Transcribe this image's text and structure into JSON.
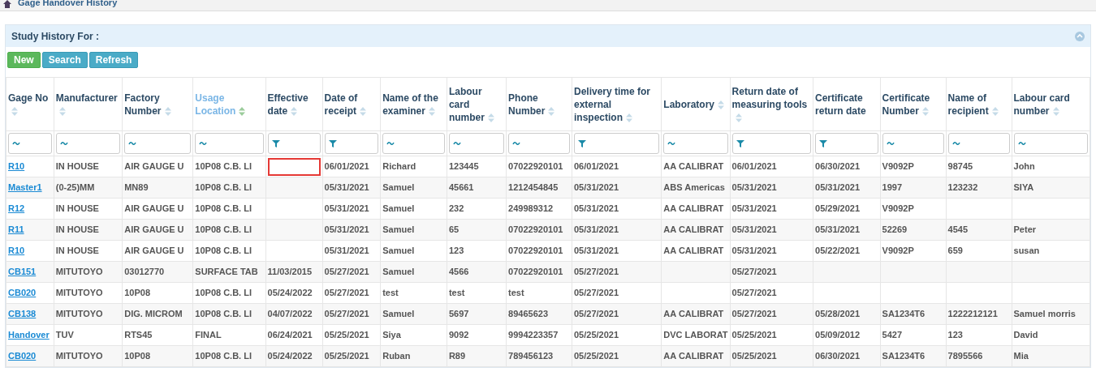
{
  "breadcrumb": {
    "title": "Gage Handover History"
  },
  "panel": {
    "title": "Study History For :",
    "collapsed": false
  },
  "buttons": [
    {
      "label": "New",
      "kind": "success"
    },
    {
      "label": "Search",
      "kind": "info"
    },
    {
      "label": "Refresh",
      "kind": "info"
    }
  ],
  "table": {
    "columns": [
      {
        "label": "Gage No",
        "sortable": true,
        "sorted": false,
        "filter": {
          "kind": "text"
        }
      },
      {
        "label": "Manufacturer",
        "sortable": true,
        "sorted": false,
        "filter": {
          "kind": "text"
        }
      },
      {
        "label": "Factory Number",
        "sortable": true,
        "sorted": false,
        "filter": {
          "kind": "text"
        }
      },
      {
        "label": "Usage Location",
        "sortable": true,
        "sorted": true,
        "filter": {
          "kind": "text"
        }
      },
      {
        "label": "Effective date",
        "sortable": true,
        "sorted": false,
        "filter": {
          "kind": "date"
        }
      },
      {
        "label": "Date of receipt",
        "sortable": true,
        "sorted": false,
        "filter": {
          "kind": "date"
        }
      },
      {
        "label": "Name of the examiner",
        "sortable": true,
        "sorted": false,
        "filter": {
          "kind": "text"
        }
      },
      {
        "label": "Labour card number",
        "sortable": true,
        "sorted": false,
        "filter": {
          "kind": "text"
        }
      },
      {
        "label": "Phone Number",
        "sortable": true,
        "sorted": false,
        "filter": {
          "kind": "text"
        }
      },
      {
        "label": "Delivery time for external inspection",
        "sortable": true,
        "sorted": false,
        "filter": {
          "kind": "date"
        }
      },
      {
        "label": "Laboratory",
        "sortable": true,
        "sorted": false,
        "filter": {
          "kind": "text"
        }
      },
      {
        "label": "Return date of measuring tools",
        "sortable": true,
        "sorted": false,
        "filter": {
          "kind": "date"
        }
      },
      {
        "label": "Certificate return date",
        "sortable": false,
        "sorted": false,
        "filter": {
          "kind": "date"
        }
      },
      {
        "label": "Certificate Number",
        "sortable": true,
        "sorted": false,
        "filter": {
          "kind": "text"
        }
      },
      {
        "label": "Name of recipient",
        "sortable": true,
        "sorted": false,
        "filter": {
          "kind": "text"
        }
      },
      {
        "label": "Labour card number",
        "sortable": true,
        "sorted": false,
        "filter": {
          "kind": "text"
        }
      }
    ],
    "rows": [
      {
        "cells": [
          "R10",
          "IN HOUSE",
          "AIR GAUGE U",
          "10P08 C.B. LI",
          {
            "text": "",
            "outlined": true
          },
          "06/01/2021",
          "Richard",
          "123445",
          "07022920101",
          "06/01/2021",
          "AA CALIBRAT",
          "06/01/2021",
          "06/30/2021",
          "V9092P",
          "98745",
          "John"
        ]
      },
      {
        "cells": [
          "Master1",
          "(0-25)MM",
          "MN89",
          "10P08 C.B. LI",
          "",
          "05/31/2021",
          "Samuel",
          "45661",
          "1212454845",
          "05/31/2021",
          "ABS Americas",
          "05/31/2021",
          "05/31/2021",
          "1997",
          "123232",
          "SIYA"
        ]
      },
      {
        "cells": [
          "R12",
          "IN HOUSE",
          "AIR GAUGE U",
          "10P08 C.B. LI",
          "",
          "05/31/2021",
          "Samuel",
          "232",
          "249989312",
          "05/31/2021",
          "AA CALIBRAT",
          "05/31/2021",
          "05/29/2021",
          "V9092P",
          "",
          ""
        ]
      },
      {
        "cells": [
          "R11",
          "IN HOUSE",
          "AIR GAUGE U",
          "10P08 C.B. LI",
          "",
          "05/31/2021",
          "Samuel",
          "65",
          "07022920101",
          "05/31/2021",
          "AA CALIBRAT",
          "05/31/2021",
          "05/31/2021",
          "52269",
          "4545",
          "Peter"
        ]
      },
      {
        "cells": [
          "R10",
          "IN HOUSE",
          "AIR GAUGE U",
          "10P08 C.B. LI",
          "",
          "05/31/2021",
          "Samuel",
          "123",
          "07022920101",
          "05/31/2021",
          "AA CALIBRAT",
          "05/31/2021",
          "05/22/2021",
          "V9092P",
          "659",
          "susan"
        ]
      },
      {
        "cells": [
          "CB151",
          "MITUTOYO",
          "03012770",
          "SURFACE TAB",
          "11/03/2015",
          "05/27/2021",
          "Samuel",
          "4566",
          "07022920101",
          "05/27/2021",
          "",
          "05/27/2021",
          "",
          "",
          "",
          ""
        ]
      },
      {
        "cells": [
          "CB020",
          "MITUTOYO",
          "10P08",
          "10P08 C.B. LI",
          "05/24/2022",
          "05/27/2021",
          "test",
          "test",
          "test",
          "05/27/2021",
          "",
          "05/27/2021",
          "",
          "",
          "",
          ""
        ]
      },
      {
        "cells": [
          "CB138",
          "MITUTOYO",
          "DIG. MICROM",
          "10P08 C.B. LI",
          "04/07/2022",
          "05/27/2021",
          "Samuel",
          "5697",
          "89465623",
          "05/27/2021",
          "AA CALIBRAT",
          "05/27/2021",
          "05/28/2021",
          "SA1234T6",
          "1222212121",
          "Samuel morris"
        ]
      },
      {
        "cells": [
          "Handover",
          "TUV",
          "RTS45",
          "FINAL",
          "06/24/2021",
          "05/25/2021",
          "Siya",
          "9092",
          "9994223357",
          "05/25/2021",
          "DVC LABORAT",
          "05/25/2021",
          "05/09/2012",
          "5427",
          "123",
          "David"
        ]
      },
      {
        "cells": [
          "CB020",
          "MITUTOYO",
          "10P08",
          "10P08 C.B. LI",
          "05/24/2022",
          "05/25/2021",
          "Ruban",
          "R89",
          "789456123",
          "05/25/2021",
          "AA CALIBRAT",
          "05/25/2021",
          "06/30/2021",
          "SA1234T6",
          "7895566",
          "Mia"
        ]
      }
    ]
  }
}
